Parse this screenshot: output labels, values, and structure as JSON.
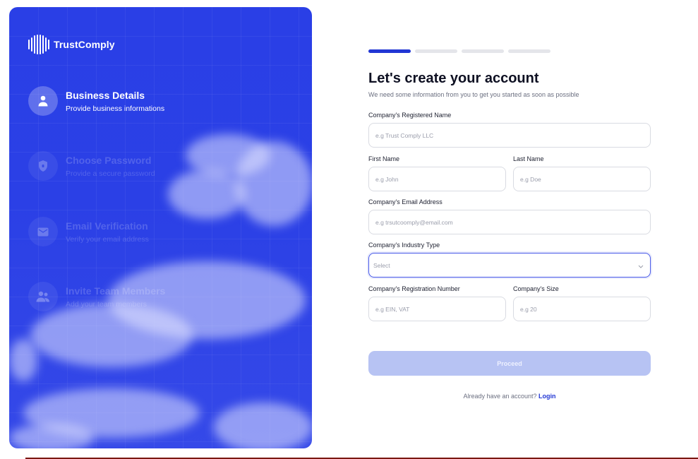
{
  "brand": {
    "name": "TrustComply"
  },
  "steps": [
    {
      "title": "Business Details",
      "subtitle": "Provide business informations",
      "icon": "user-icon",
      "state": "active"
    },
    {
      "title": "Choose Password",
      "subtitle": "Provide a secure password",
      "icon": "shield-lock-icon",
      "state": "inactive"
    },
    {
      "title": "Email Verification",
      "subtitle": "Verify your email address",
      "icon": "mail-icon",
      "state": "inactive"
    },
    {
      "title": "Invite Team Members",
      "subtitle": "Add your team members",
      "icon": "users-icon",
      "state": "inactive"
    }
  ],
  "progress": {
    "current_step": 1,
    "total_steps": 4
  },
  "form": {
    "title": "Let's create your account",
    "subtitle": "We need some information from you to get you started as soon as possible",
    "company_name": {
      "label": "Company's Registered Name",
      "placeholder": "e.g Trust Comply LLC",
      "value": ""
    },
    "first_name": {
      "label": "First Name",
      "placeholder": "e.g John",
      "value": ""
    },
    "last_name": {
      "label": "Last Name",
      "placeholder": "e.g Doe",
      "value": ""
    },
    "email": {
      "label": "Company's Email Address",
      "placeholder": "e.g trsutcoomply@email.com",
      "value": ""
    },
    "industry": {
      "label": "Company's Industry Type",
      "selected": "Select"
    },
    "registration_number": {
      "label": "Company's Registration Number",
      "placeholder": "e.g EIN, VAT",
      "value": ""
    },
    "size": {
      "label": "Company's Size",
      "placeholder": "e.g 20",
      "value": ""
    },
    "submit_label": "Proceed",
    "signin_prompt": "Already have an account?",
    "signin_link": "Login"
  },
  "colors": {
    "primary": "#2136d4",
    "panel": "#2b40e6",
    "button_disabled": "#b7c3f3"
  }
}
